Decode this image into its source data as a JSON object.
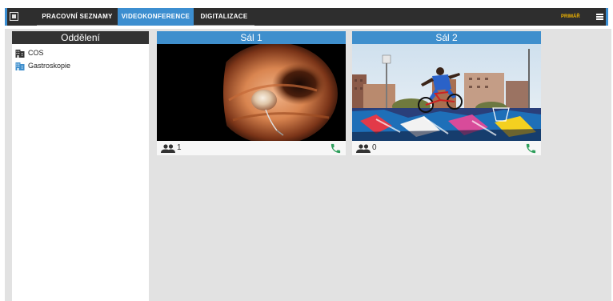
{
  "nav": {
    "tabs": [
      {
        "label": "PRACOVNÍ SEZNAMY"
      },
      {
        "label": "VIDEOKONFERENCE"
      },
      {
        "label": "DIGITALIZACE"
      }
    ],
    "active_tab": "VIDEOKONFERENCE",
    "right_label": "PRIMÁŘ"
  },
  "sidebar": {
    "title": "Oddělení",
    "items": [
      {
        "label": "COS",
        "icon": "building-icon"
      },
      {
        "label": "Gastroskopie",
        "icon": "building-icon"
      }
    ]
  },
  "rooms": [
    {
      "name": "Sál 1",
      "participants": "1",
      "video": "endoscopy"
    },
    {
      "name": "Sál 2",
      "participants": "0",
      "video": "bmx-jump"
    }
  ],
  "colors": {
    "topbar": "#2e2e2e",
    "active_tab": "#3c8ed0",
    "card_header": "#3f8fcd",
    "call_icon": "#2e9e5b",
    "background": "#e2e2e2"
  }
}
